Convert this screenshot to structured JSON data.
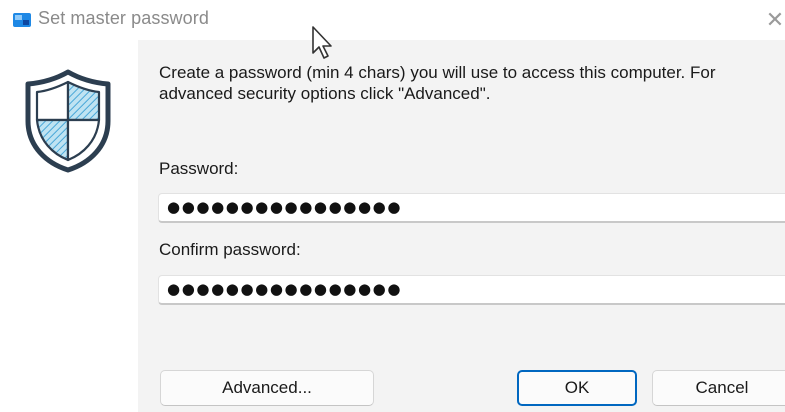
{
  "window": {
    "title": "Set master password",
    "close_icon": "close-icon",
    "app_icon": "app-shield-icon"
  },
  "content": {
    "description_line1": "Create a password (min 4 chars) you will use to access this computer. For",
    "description_line2": "advanced security options click \"Advanced\".",
    "password_label": "Password:",
    "password_value": "●●●●●●●●●●●●●●●●",
    "confirm_label": "Confirm password:",
    "confirm_value": "●●●●●●●●●●●●●●●●",
    "illustration_icon": "shield-icon"
  },
  "buttons": {
    "advanced_label": "Advanced...",
    "ok_label": "OK",
    "cancel_label": "Cancel"
  },
  "colors": {
    "accent": "#0067c0",
    "shield_stroke": "#2c3e50",
    "shield_fill": "#9fd3ea"
  }
}
